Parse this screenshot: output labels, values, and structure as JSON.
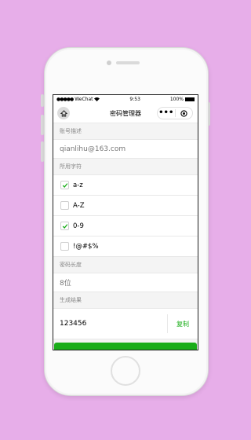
{
  "status_bar": {
    "carrier": "WeChat",
    "time": "9:53",
    "battery": "100%"
  },
  "navbar": {
    "title": "密码管理器",
    "more_label": "•••"
  },
  "account": {
    "label": "账号描述",
    "value": "qianlihu@163.com"
  },
  "charset": {
    "label": "所用字符",
    "options": [
      {
        "label": "a-z",
        "checked": true
      },
      {
        "label": "A-Z",
        "checked": false
      },
      {
        "label": "0-9",
        "checked": true
      },
      {
        "label": "!@#$%",
        "checked": false
      }
    ]
  },
  "length": {
    "label": "密码长度",
    "value": "8位"
  },
  "result": {
    "label": "生成结果",
    "value": "123456",
    "copy_label": "复制"
  },
  "colors": {
    "accent": "#1aad19",
    "background": "#e7aee9"
  }
}
